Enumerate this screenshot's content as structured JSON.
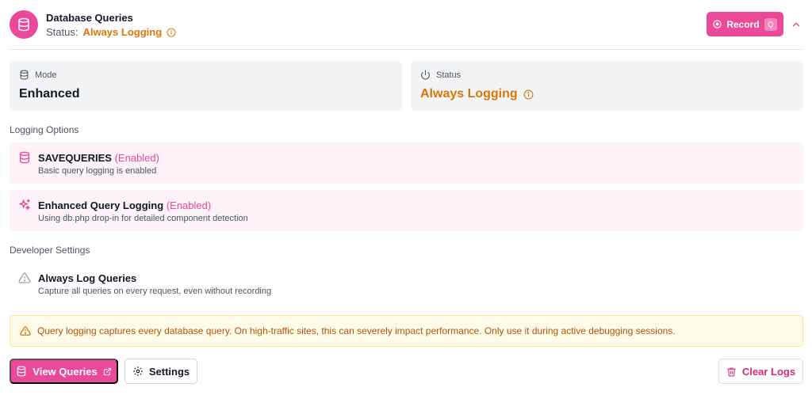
{
  "header": {
    "title": "Database Queries",
    "status_label": "Status:",
    "status_value": "Always Logging",
    "record_label": "Record",
    "record_shortcut": "Q"
  },
  "cards": {
    "mode": {
      "label": "Mode",
      "value": "Enhanced"
    },
    "status": {
      "label": "Status",
      "value": "Always Logging"
    }
  },
  "logging_options": {
    "heading": "Logging Options",
    "items": [
      {
        "title": "SAVEQUERIES",
        "state": "(Enabled)",
        "desc": "Basic query logging is enabled"
      },
      {
        "title": "Enhanced Query Logging",
        "state": "(Enabled)",
        "desc": "Using db.php drop-in for detailed component detection"
      }
    ]
  },
  "developer_settings": {
    "heading": "Developer Settings",
    "items": [
      {
        "title": "Always Log Queries",
        "desc": "Capture all queries on every request, even without recording"
      }
    ]
  },
  "warning": "Query logging captures every database query. On high-traffic sites, this can severely impact performance. Only use it during active debugging sessions.",
  "footer": {
    "view_queries": "View Queries",
    "settings": "Settings",
    "clear_logs": "Clear Logs"
  },
  "colors": {
    "accent": "#ec4899",
    "warning": "#d97706",
    "option_bg": "#fdf2f8"
  },
  "icons": [
    "database-icon",
    "info-icon",
    "record-icon",
    "chevron-up-icon",
    "power-icon",
    "sparkles-icon",
    "warning-triangle-icon",
    "external-link-icon",
    "gear-icon",
    "trash-icon"
  ]
}
